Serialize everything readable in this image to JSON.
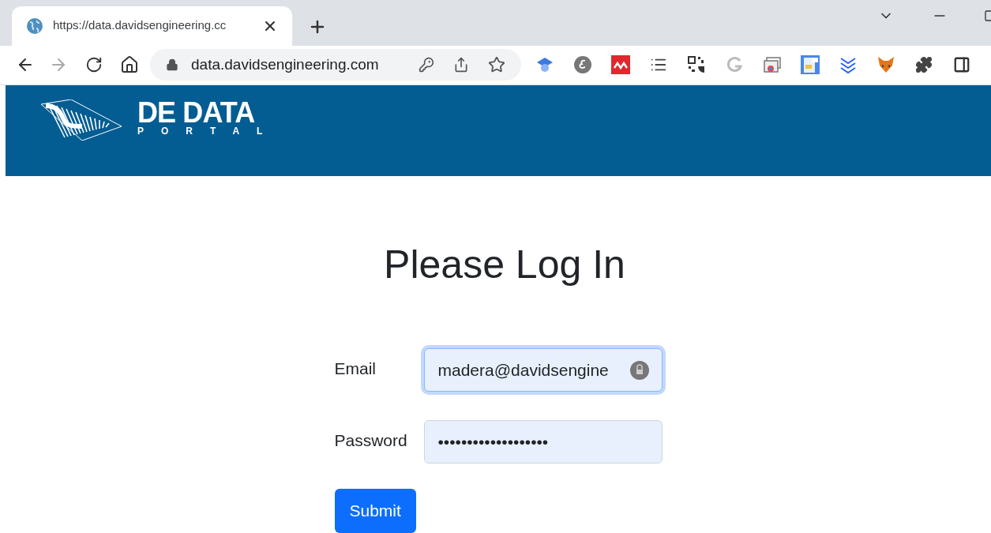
{
  "browser": {
    "tab": {
      "title": "https://data.davidsengineering.cc",
      "selected": true
    },
    "address": "data.davidsengineering.com"
  },
  "header": {
    "logo_title": "DE DATA",
    "logo_subtitle": "PORTAL"
  },
  "login": {
    "heading": "Please Log In",
    "fields": [
      {
        "label": "Email",
        "value": "madera@davidsengine",
        "focused": true
      },
      {
        "label": "Password",
        "value": "•••••••••••••••••••",
        "focused": false
      }
    ],
    "submit": "Submit"
  }
}
